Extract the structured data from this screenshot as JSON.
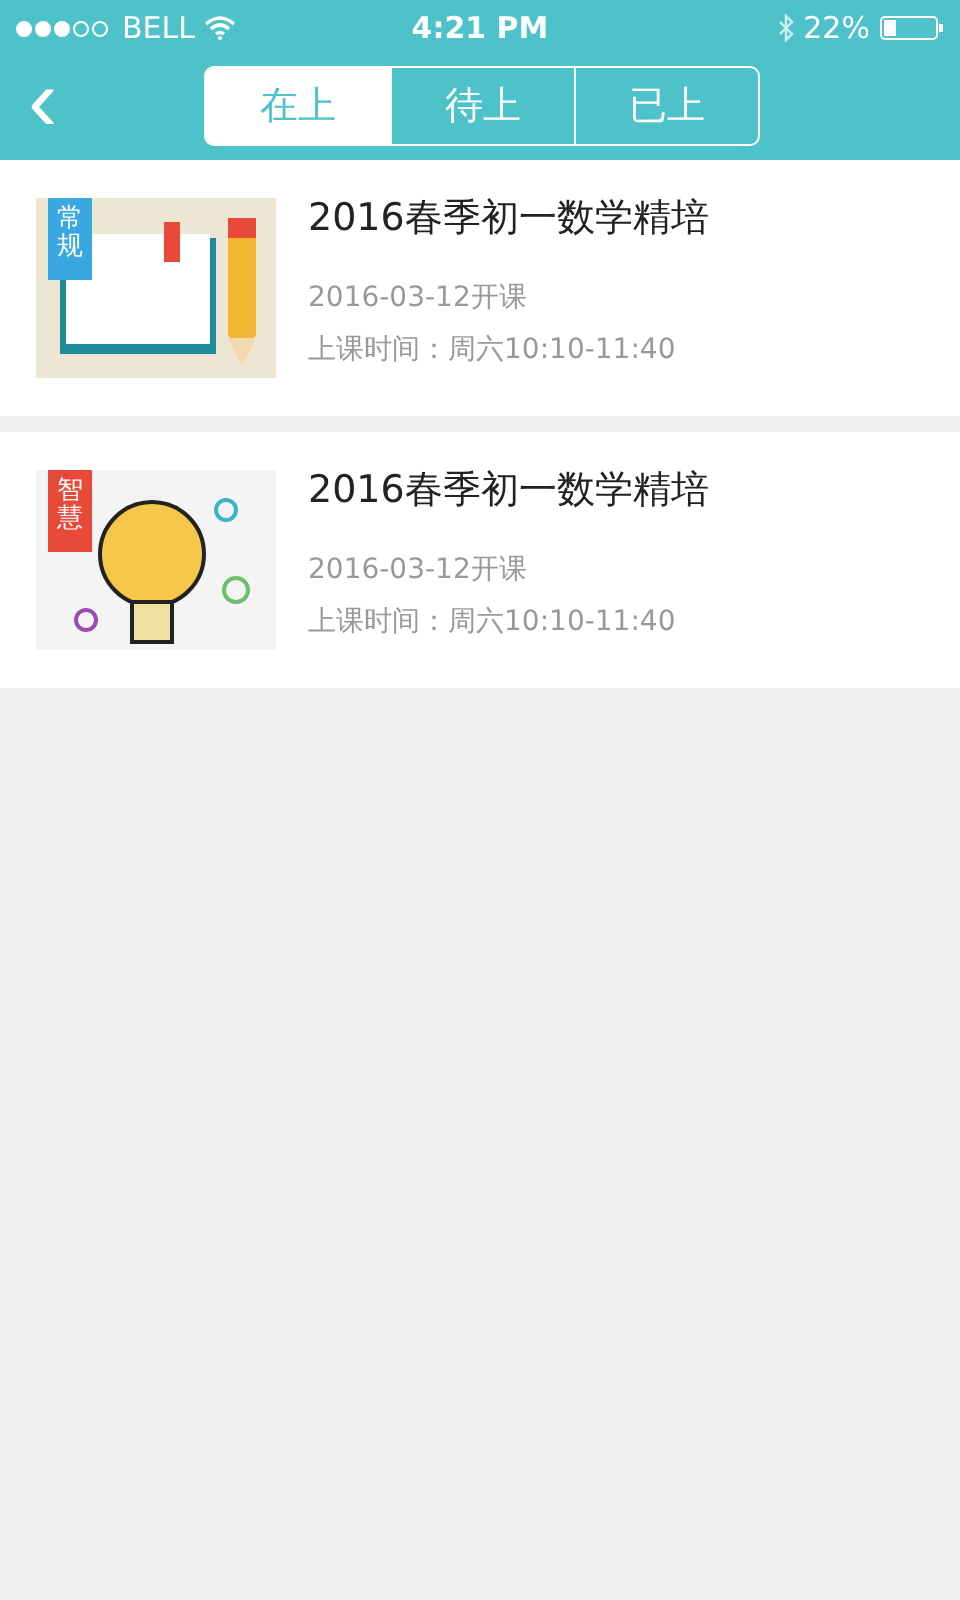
{
  "status_bar": {
    "carrier": "BELL",
    "time": "4:21 PM",
    "battery": "22%"
  },
  "nav": {
    "back": "‹",
    "tabs": [
      {
        "label": "在上",
        "selected": true
      },
      {
        "label": "待上",
        "selected": false
      },
      {
        "label": "已上",
        "selected": false
      }
    ]
  },
  "courses": [
    {
      "kind": "book",
      "ribbon": "常规",
      "color": "#3aa8e0",
      "title": "2016春季初一数学精培",
      "start": "2016-03-12开课",
      "schedule": "上课时间：周六10:10-11:40"
    },
    {
      "kind": "bulb",
      "ribbon": "智慧",
      "color": "#e84a3a",
      "title": "2016春季初一数学精培",
      "start": "2016-03-12开课",
      "schedule": "上课时间：周六10:10-11:40"
    }
  ]
}
